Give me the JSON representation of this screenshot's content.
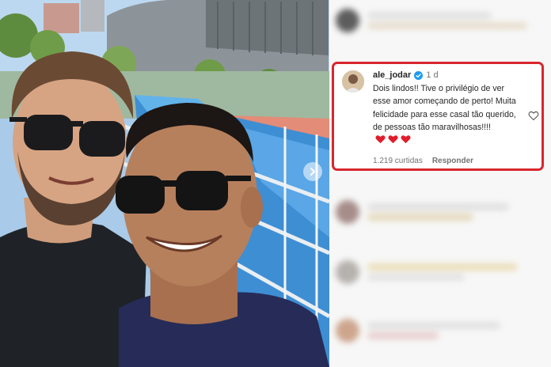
{
  "comment": {
    "username": "ale_jodar",
    "time": "1 d",
    "text": "Dois lindos!! Tive o privilégio de ver esse amor começando de perto! Muita felicidade para esse casal tão querido, de pessoas tão maravilhosas!!!!",
    "likes": "1.219 curtidas",
    "reply_label": "Responder",
    "reaction_hearts": 3
  },
  "colors": {
    "highlight_border": "#d8262f",
    "verified": "#1d9bf0",
    "heart": "#e11d2b"
  },
  "icons": {
    "verified": "verified-badge-icon",
    "like": "heart-outline-icon",
    "carousel": "chevron-right-icon"
  }
}
